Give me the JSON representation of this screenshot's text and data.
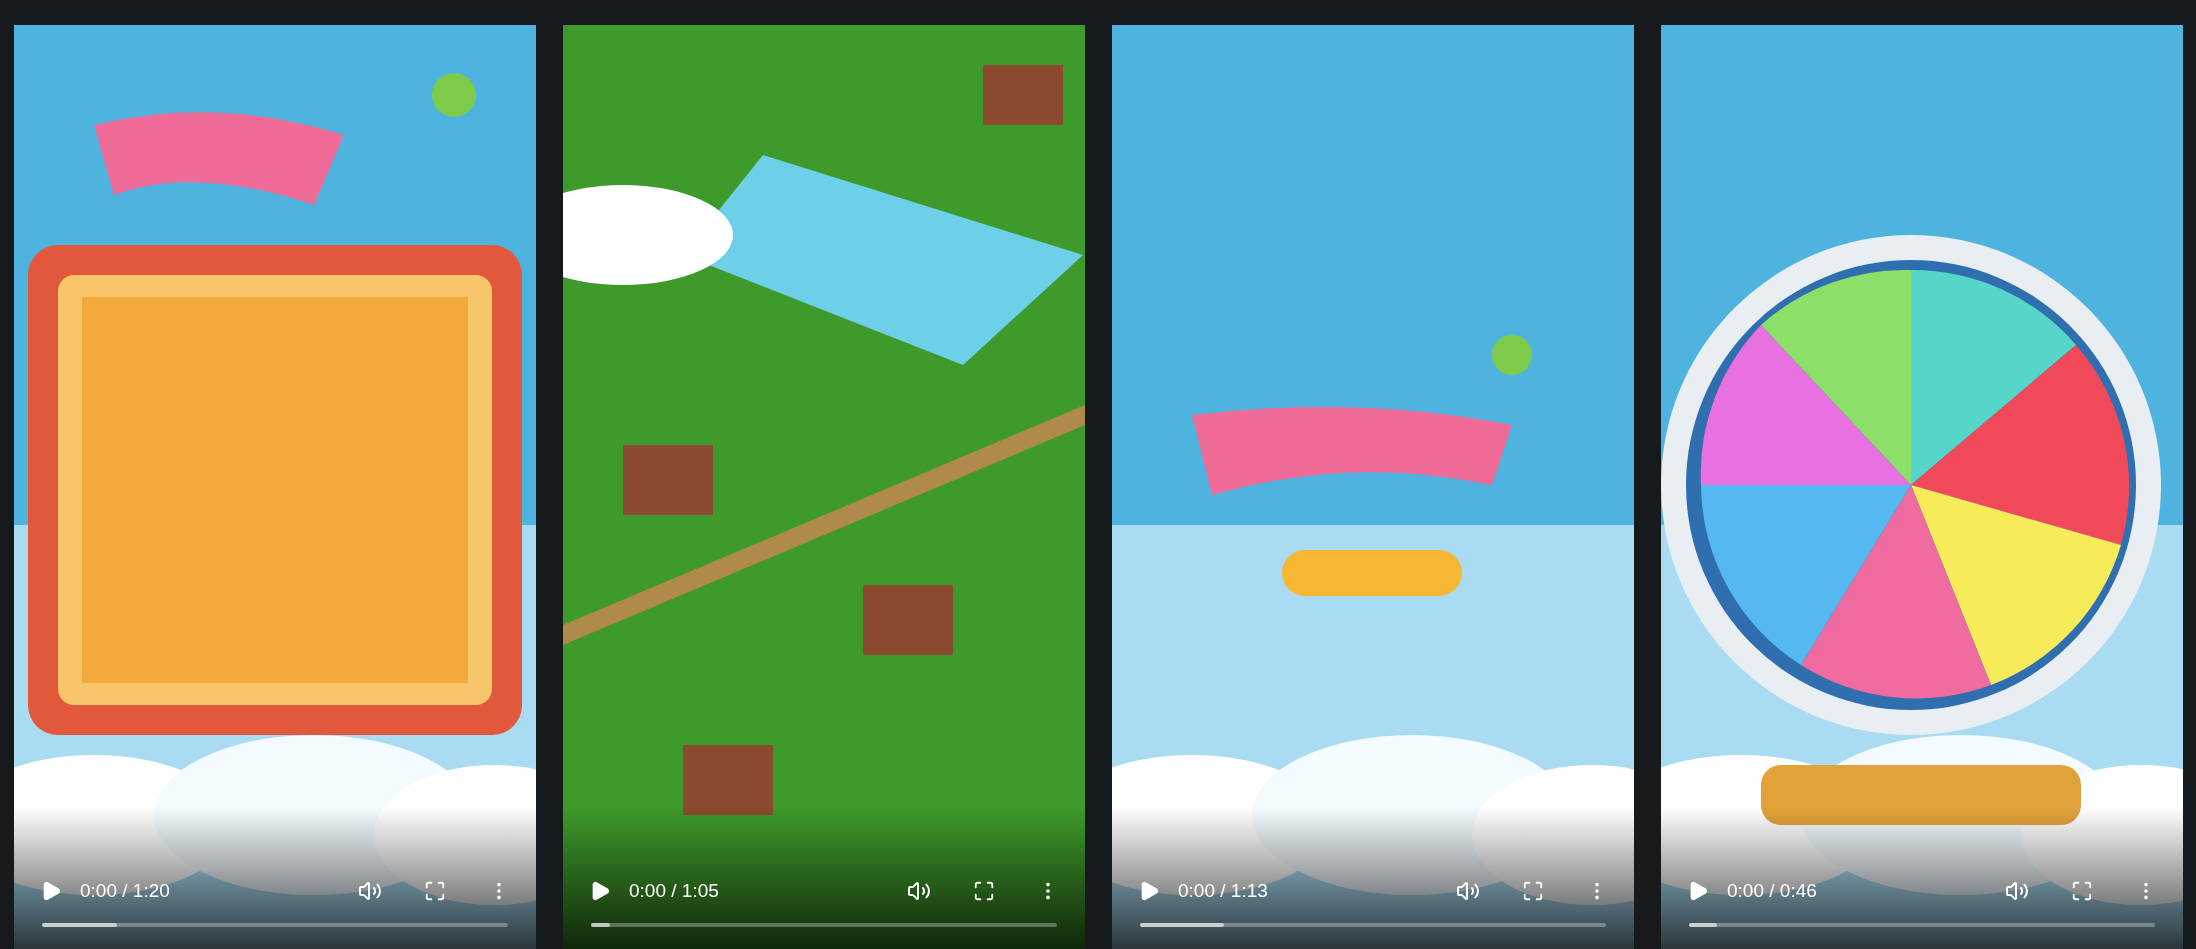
{
  "videos": [
    {
      "time": "0:00 / 1:20",
      "buffer": {
        "level": 0.16
      }
    },
    {
      "time": "0:00 / 1:05",
      "buffer": {
        "level": 0.04
      }
    },
    {
      "time": "0:00 / 1:13",
      "buffer": {
        "level": 0.18
      }
    },
    {
      "time": "0:00 / 0:46",
      "buffer": {
        "level": 0.06
      }
    }
  ]
}
